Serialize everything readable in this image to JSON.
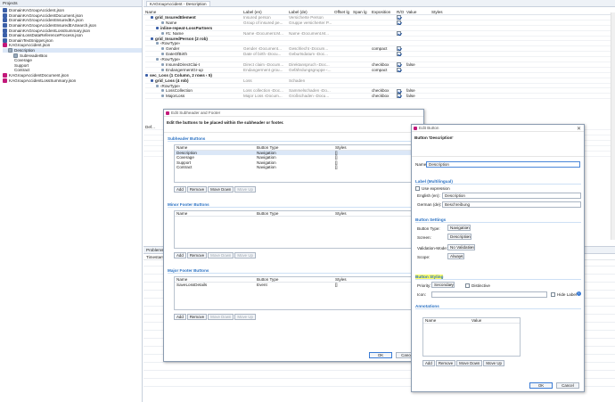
{
  "colors": {
    "accent": "#2b72c4",
    "json_icon": "#3b5fa8",
    "package_icon": "#c2187a",
    "highlight": "#ffff66"
  },
  "projects_panel": {
    "title": "Projects",
    "files": [
      {
        "name": "DomainKAGroupAccident.json",
        "icon": "json",
        "indent": 0
      },
      {
        "name": "DomainKAGroupAccidentDocument.json",
        "icon": "json",
        "indent": 0
      },
      {
        "name": "DomainKAGroupAccidentInsuredEA.json",
        "icon": "json",
        "indent": 0
      },
      {
        "name": "DomainKAGroupAccidentInsuredEASearch.json",
        "icon": "json",
        "indent": 0
      },
      {
        "name": "DomainKAGroupAccidentLossSummary.json",
        "icon": "json",
        "indent": 0
      },
      {
        "name": "DomainLossDataReferenceProcess.json",
        "icon": "json",
        "indent": 0
      },
      {
        "name": "DomainTextSnippet.json",
        "icon": "json",
        "indent": 0
      },
      {
        "name": "KAGroupAccident.json",
        "icon": "package",
        "indent": 0
      },
      {
        "name": "Description",
        "icon": "sub",
        "indent": 1
      },
      {
        "name": "SubHeaderBox",
        "icon": "sub",
        "indent": 2
      },
      {
        "name": "Coverage",
        "icon": "none",
        "indent": 1
      },
      {
        "name": "Support",
        "icon": "none",
        "indent": 1
      },
      {
        "name": "Contract",
        "icon": "none",
        "indent": 1
      },
      {
        "name": "KAGroupAccidentDocument.json",
        "icon": "package",
        "indent": 0
      },
      {
        "name": "KAGroupAccidentLossSummary.json",
        "icon": "package",
        "indent": 0
      }
    ]
  },
  "editor": {
    "tab": "KAGroupAccident - Description",
    "columns": [
      "Name",
      "Label (en)",
      "Label (de)",
      "Offset lg",
      "Span lg",
      "Exposition",
      "R/O",
      "Value",
      "Styles"
    ],
    "rows": [
      {
        "name": "grid_InsuredElement",
        "en": "Insured person",
        "de": "Versicherte Person",
        "expo": "",
        "ro": true,
        "val": "",
        "bold": true,
        "indent": 1
      },
      {
        "name": "Name",
        "en": "Group of insured pe...",
        "de": "Gruppe versicherter P...",
        "expo": "",
        "ro": true,
        "val": "",
        "bold": false,
        "indent": 3
      },
      {
        "name": "inline-repeat-LossPartners",
        "en": "",
        "de": "",
        "expo": "",
        "ro": false,
        "val": "",
        "bold": true,
        "indent": 2
      },
      {
        "name": "#1: Name",
        "en": "Name ‹Document.M...",
        "de": "Name ‹Document.M...",
        "expo": "",
        "ro": true,
        "val": "",
        "bold": false,
        "indent": 3
      },
      {
        "name": "grid_InsuredPerson  (2 rob)",
        "en": "",
        "de": "",
        "expo": "",
        "ro": false,
        "val": "",
        "bold": true,
        "indent": 1
      },
      {
        "name": "‹RowType›",
        "en": "",
        "de": "",
        "expo": "",
        "ro": false,
        "val": "",
        "bold": false,
        "indent": 2
      },
      {
        "name": "Gender",
        "en": "Gender ‹Document...",
        "de": "Geschlecht ‹Docum...",
        "expo": "compact",
        "ro": true,
        "val": "",
        "bold": false,
        "indent": 3
      },
      {
        "name": "DateOfBirth",
        "en": "Date of birth ‹Docu...",
        "de": "Geburtsdatum ‹Doc...",
        "expo": "",
        "ro": true,
        "val": "",
        "bold": false,
        "indent": 3
      },
      {
        "name": "‹RowType›",
        "en": "",
        "de": "",
        "expo": "",
        "ro": false,
        "val": "",
        "bold": false,
        "indent": 2
      },
      {
        "name": "InsuredDirectClai-t",
        "en": "Direct claim ‹Docum...",
        "de": "Direktanspruch ‹Doc...",
        "expo": "checkbox",
        "ro": true,
        "val": "false",
        "bold": false,
        "indent": 3
      },
      {
        "name": "EndangermentGr-up",
        "en": "Endangerment grou...",
        "de": "Gefährdungsgruppe ‹...",
        "expo": "compact",
        "ro": true,
        "val": "",
        "bold": false,
        "indent": 3
      },
      {
        "name": "sec_Loss  (1 Column, 2 rows ‹ 5)",
        "en": "",
        "de": "",
        "expo": "",
        "ro": false,
        "val": "",
        "bold": true,
        "indent": 0
      },
      {
        "name": "grid_Loss  (4 rob)",
        "en": "Loss",
        "de": "Schaden",
        "expo": "",
        "ro": false,
        "val": "",
        "bold": true,
        "indent": 1
      },
      {
        "name": "‹RowType›",
        "en": "",
        "de": "",
        "expo": "",
        "ro": false,
        "val": "",
        "bold": false,
        "indent": 2
      },
      {
        "name": "LossCollection",
        "en": "Loss collection ‹Doc...",
        "de": "Sammelschaden ‹Do...",
        "expo": "checkbox",
        "ro": true,
        "val": "false",
        "bold": false,
        "indent": 3
      },
      {
        "name": "MajorLoss",
        "en": "Major Loss ‹Docum...",
        "de": "Großschaden ‹Docu...",
        "expo": "checkbox",
        "ro": true,
        "val": "false",
        "bold": false,
        "indent": 3
      }
    ],
    "lower_rows": [
      "Def...",
      "",
      "",
      "",
      "",
      ""
    ]
  },
  "problems_tab": "Problems",
  "timestamp_col": "Timestam",
  "subheader_dialog": {
    "title": "Edit Subheader and Footer",
    "instruction": "Edit the buttons to be placed within the subheader or footer.",
    "sections": [
      {
        "title": "Subheader Buttons",
        "cols": [
          "Name",
          "Button Type",
          "Styles"
        ],
        "rows": [
          {
            "name": "Description",
            "type": "Navigation",
            "styles": "[]",
            "selected": true
          },
          {
            "name": "Coverage",
            "type": "Navigation",
            "styles": "[]",
            "selected": false
          },
          {
            "name": "Support",
            "type": "Navigation",
            "styles": "[]",
            "selected": false
          },
          {
            "name": "Contract",
            "type": "Navigation",
            "styles": "[]",
            "selected": false
          }
        ],
        "buttons": [
          "Add",
          "Remove",
          "Move Down",
          "Move Up"
        ]
      },
      {
        "title": "Minor Footer Buttons",
        "cols": [
          "Name",
          "Button Type",
          "Styles"
        ],
        "rows": [],
        "buttons": [
          "Add",
          "Remove",
          "Move Down",
          "Move Up"
        ]
      },
      {
        "title": "Major Footer Buttons",
        "cols": [
          "Name",
          "Button Type",
          "Styles"
        ],
        "rows": [
          {
            "name": "SaveLossDetails",
            "type": "Event",
            "styles": "[]",
            "selected": false
          }
        ],
        "buttons": [
          "Add",
          "Remove",
          "Move Down",
          "Move Up"
        ]
      }
    ],
    "ok": "OK",
    "cancel": "Cancel"
  },
  "button_dialog": {
    "title": "Edit Button",
    "heading": "Button 'Description'",
    "name_label": "Name:",
    "name_value": "Description",
    "label_section": "Label (Multilingual)",
    "use_expression": "Use expression",
    "english_label": "English (en):",
    "english_value": "Description",
    "german_label": "German (de):",
    "german_value": "Beschreibung",
    "settings_section": "Button Settings",
    "button_type_label": "Button Type:",
    "button_type_value": "Navigation",
    "screen_label": "Screen:",
    "screen_value": "Description",
    "validation_label": "Validation-Mode:",
    "validation_value": "No Validation",
    "scope_label": "Scope:",
    "scope_value": "Always",
    "styling_section": "Button Styling",
    "priority_label": "Priority:",
    "priority_value": "Secondary",
    "distinctive": "Distinctive",
    "icon_label": "Icon:",
    "hide_label": "Hide Label",
    "annotations_section": "Annotations",
    "ann_cols": [
      "Name",
      "Value"
    ],
    "ann_buttons": [
      "Add",
      "Remove",
      "Move Down",
      "Move Up"
    ],
    "ok": "OK",
    "cancel": "Cancel"
  }
}
